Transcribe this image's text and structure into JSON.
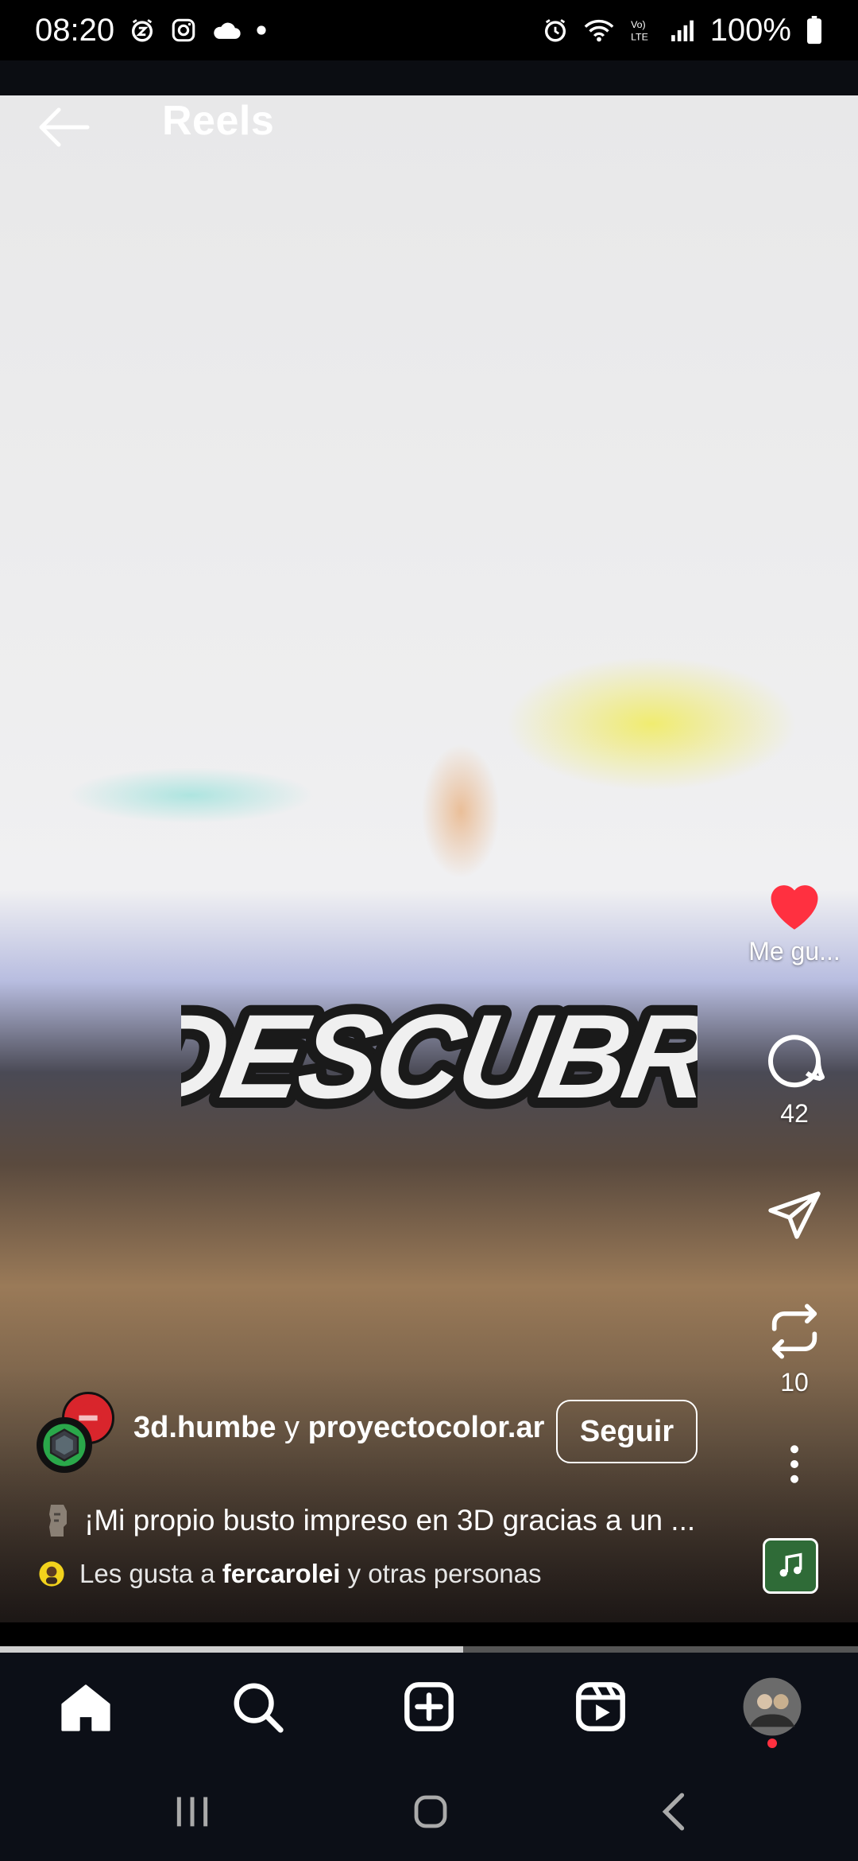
{
  "status": {
    "time": "08:20",
    "battery": "100%",
    "left_icons": [
      "alarm-z-icon",
      "instagram-icon",
      "cloud-icon",
      "dot-icon"
    ],
    "right_icons": [
      "alarm-icon",
      "wifi-icon",
      "volte-icon",
      "signal-icon",
      "battery-icon"
    ]
  },
  "header": {
    "title": "Reels"
  },
  "reel": {
    "sticker_text": "DESCUBRÍ",
    "actions": {
      "like_label": "Me gu...",
      "comment_count": "42",
      "repost_count": "10"
    },
    "owner1": "3d.humbe",
    "owner_joiner": "y",
    "owner2": "proyectocolor.ar",
    "follow_label": "Seguir",
    "caption": "¡Mi propio busto impreso en 3D gracias a un ...",
    "likes_prefix": "Les gusta a",
    "likes_user": "fercarolei",
    "likes_suffix": "y otras personas",
    "progress": 0.54
  },
  "colors": {
    "like_red": "#ff3040",
    "tabbar_bg": "#0c0f17",
    "audio_green": "#2f6b37"
  },
  "tabs": [
    "home-icon",
    "search-icon",
    "create-icon",
    "reels-icon",
    "profile-avatar"
  ]
}
